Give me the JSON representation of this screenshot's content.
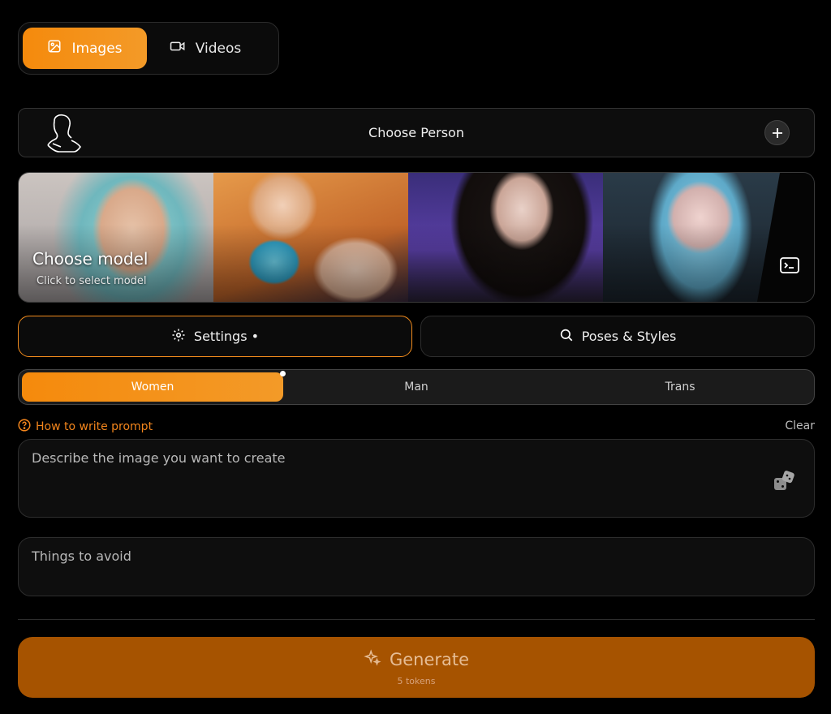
{
  "media_tabs": {
    "images_label": "Images",
    "videos_label": "Videos",
    "active": "Images",
    "images_icon": "image-icon",
    "videos_icon": "video-camera-icon"
  },
  "person": {
    "label": "Choose Person",
    "icon": "person-silhouette-icon",
    "add_icon": "plus-icon"
  },
  "model": {
    "title": "Choose model",
    "subtitle": "Click to select model",
    "side_icon": "terminal-icon"
  },
  "actions": {
    "settings_label": "Settings •",
    "settings_icon": "gear-icon",
    "poses_label": "Poses & Styles",
    "poses_icon": "search-icon"
  },
  "gender": {
    "options": [
      "Women",
      "Man",
      "Trans"
    ],
    "selected": "Women"
  },
  "prompt": {
    "help_label": "How to write prompt",
    "help_icon": "question-circle-icon",
    "clear_label": "Clear",
    "placeholder": "Describe the image you want to create",
    "random_icon": "dice-icon",
    "avoid_placeholder": "Things to avoid"
  },
  "generate": {
    "label": "Generate",
    "icon": "sparkle-icon",
    "cost": "5 tokens"
  },
  "colors": {
    "accent": "#f58a0c",
    "generate_bg": "#a65300",
    "background": "#000000"
  }
}
